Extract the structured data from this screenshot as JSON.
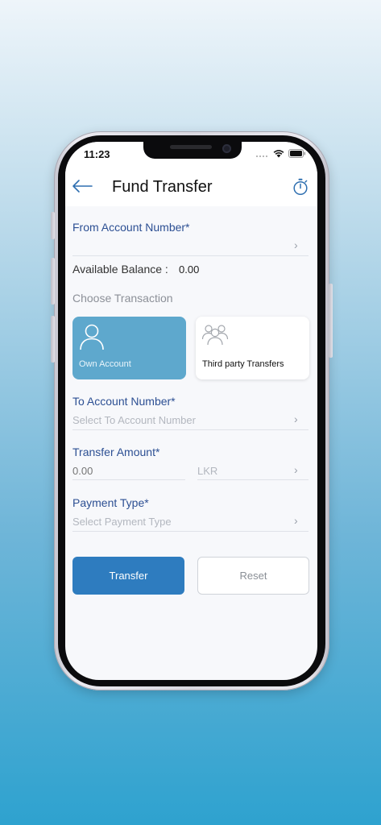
{
  "status_bar": {
    "time": "11:23"
  },
  "header": {
    "title": "Fund Transfer",
    "back_icon": "arrow-left-icon",
    "timer_icon": "stopwatch-icon"
  },
  "from_account": {
    "label": "From Account Number*",
    "value": ""
  },
  "balance": {
    "label": "Available Balance :",
    "value": "0.00"
  },
  "transaction": {
    "label": "Choose Transaction",
    "options": [
      {
        "label": "Own Account",
        "icon": "person-icon",
        "selected": true
      },
      {
        "label": "Third party Transfers",
        "icon": "group-icon",
        "selected": false
      }
    ]
  },
  "to_account": {
    "label": "To Account Number*",
    "placeholder": "Select To Account Number"
  },
  "amount": {
    "label": "Transfer Amount*",
    "placeholder": "0.00",
    "currency": "LKR"
  },
  "payment_type": {
    "label": "Payment Type*",
    "placeholder": "Select Payment Type"
  },
  "actions": {
    "transfer_label": "Transfer",
    "reset_label": "Reset"
  },
  "colors": {
    "accent": "#2e7cbf",
    "label_blue": "#2c4f93",
    "selected_card": "#5ea8cd"
  }
}
